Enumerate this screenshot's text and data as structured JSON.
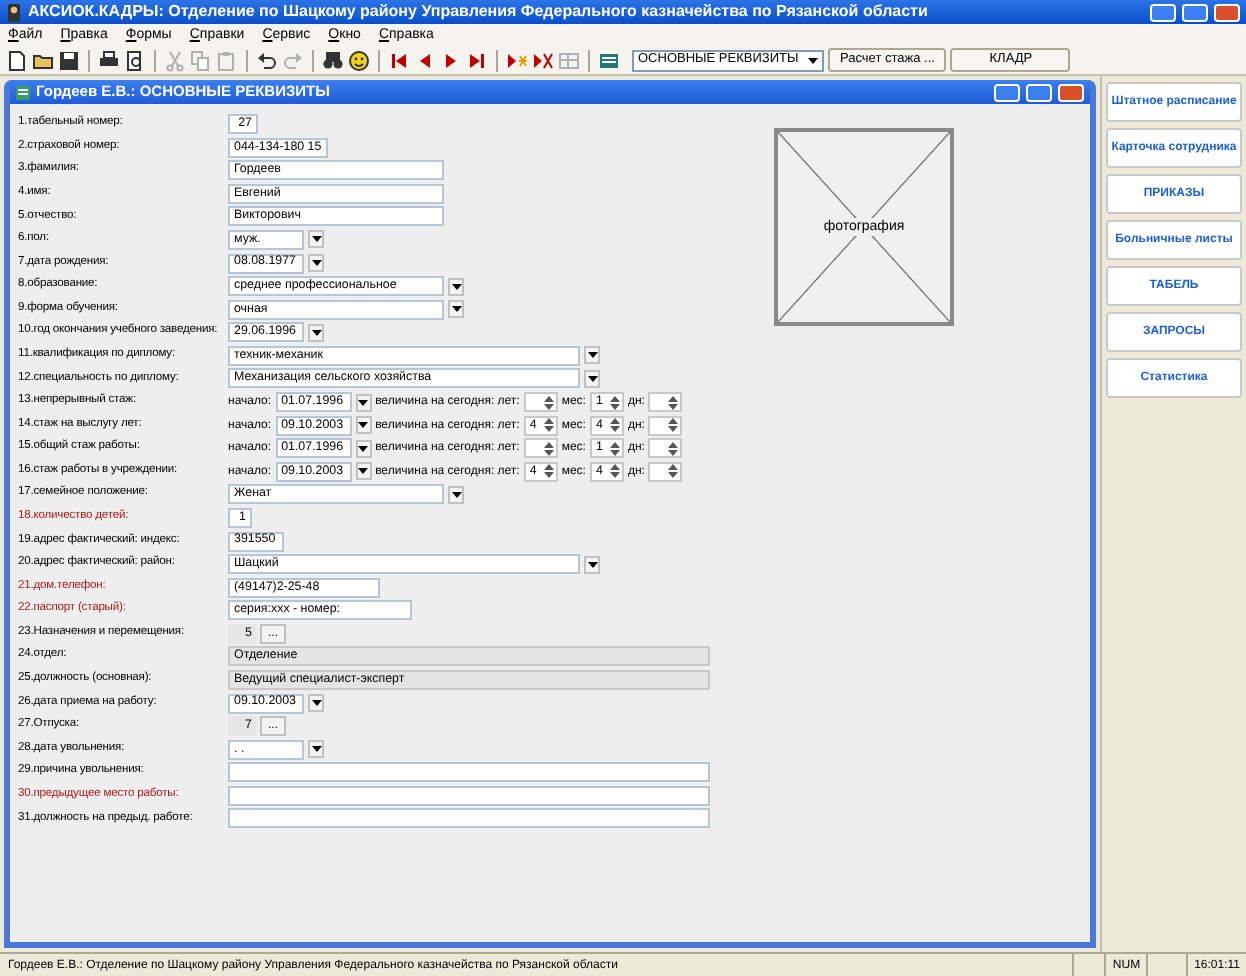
{
  "window": {
    "title": "АКСИОК.КАДРЫ: Отделение по Шацкому району Управления Федерального казначейства по Рязанской области"
  },
  "menu": [
    "Файл",
    "Правка",
    "Формы",
    "Справки",
    "Сервис",
    "Окно",
    "Справка"
  ],
  "toolbar": {
    "groups": [
      [
        {
          "kind": "new",
          "disabled": false
        },
        {
          "kind": "open",
          "disabled": false
        },
        {
          "kind": "save",
          "disabled": false
        }
      ],
      [
        {
          "kind": "print",
          "disabled": false
        },
        {
          "kind": "preview",
          "disabled": false
        }
      ],
      [
        {
          "kind": "cut",
          "disabled": true
        },
        {
          "kind": "copy",
          "disabled": true
        },
        {
          "kind": "paste",
          "disabled": true
        }
      ],
      [
        {
          "kind": "undo",
          "disabled": false
        },
        {
          "kind": "redo",
          "disabled": true
        }
      ],
      [
        {
          "kind": "find",
          "disabled": false
        },
        {
          "kind": "help",
          "disabled": false
        }
      ],
      [
        {
          "kind": "first",
          "disabled": false
        },
        {
          "kind": "prev",
          "disabled": false
        },
        {
          "kind": "next",
          "disabled": false
        },
        {
          "kind": "last",
          "disabled": false
        }
      ],
      [
        {
          "kind": "insert",
          "disabled": false
        },
        {
          "kind": "delete",
          "disabled": false
        },
        {
          "kind": "edit",
          "disabled": true
        }
      ],
      [
        {
          "kind": "form",
          "disabled": false
        }
      ]
    ],
    "form_select": "ОСНОВНЫЕ РЕКВИЗИТЫ",
    "buttons": [
      "Расчет стажа ...",
      "КЛАДР"
    ]
  },
  "document": {
    "title": "Гордеев Е.В.: ОСНОВНЫЕ РЕКВИЗИТЫ",
    "fields": [
      {
        "kind": "input",
        "label": "1.табельный номер:",
        "value": "27",
        "readonly": false,
        "required": false
      },
      {
        "kind": "input",
        "label": "2.страховой номер:",
        "value": "044-134-180 15",
        "readonly": false,
        "required": false
      },
      {
        "kind": "input",
        "label": "3.фамилия:",
        "value": "Гордеев",
        "readonly": false,
        "required": false
      },
      {
        "kind": "input",
        "label": "4.имя:",
        "value": "Евгений",
        "readonly": false,
        "required": false
      },
      {
        "kind": "input",
        "label": "5.отчество:",
        "value": "Викторович",
        "readonly": false,
        "required": false
      },
      {
        "kind": "dropdown",
        "label": "6.пол:",
        "value": "муж.",
        "required": false
      },
      {
        "kind": "dropdown",
        "label": "7.дата рождения:",
        "value": "08.08.1977",
        "required": false
      },
      {
        "kind": "dropdown",
        "label": "8.образование:",
        "value": "среднее профессиональное",
        "required": false
      },
      {
        "kind": "dropdown",
        "label": "9.форма обучения:",
        "value": "очная",
        "required": false
      },
      {
        "kind": "dropdown",
        "label": "10.год окончания учебного заведения:",
        "value": "29.06.1996",
        "required": false
      },
      {
        "kind": "dropdown",
        "label": "11.квалификация по диплому:",
        "value": "техник-механик",
        "required": false
      },
      {
        "kind": "dropdown",
        "label": "12.специальность по диплому:",
        "value": "Механизация сельского хозяйства",
        "required": false
      },
      {
        "kind": "stazh",
        "label": "13.непрерывный стаж:",
        "start_label": "начало:",
        "start": "01.07.1996",
        "amount_label": "величина на сегодня: лет:",
        "months_label": "мес:",
        "months": "1",
        "days_label": "дн:",
        "required": false
      },
      {
        "kind": "stazh",
        "label": "14.стаж на выслугу лет:",
        "start_label": "начало:",
        "start": "09.10.2003",
        "amount_label": "величина на сегодня: лет:",
        "years": "4",
        "months_label": "мес:",
        "months": "4",
        "days_label": "дн:",
        "required": false
      },
      {
        "kind": "stazh",
        "label": "15.общий стаж работы:",
        "start_label": "начало:",
        "start": "01.07.1996",
        "amount_label": "величина на сегодня: лет:",
        "months_label": "мес:",
        "months": "1",
        "days_label": "дн:",
        "required": false
      },
      {
        "kind": "stazh",
        "label": "16.стаж работы в учреждении:",
        "start_label": "начало:",
        "start": "09.10.2003",
        "amount_label": "величина на сегодня: лет:",
        "years": "4",
        "months_label": "мес:",
        "months": "4",
        "days_label": "дн:",
        "required": false
      },
      {
        "kind": "dropdown",
        "label": "17.семейное положение:",
        "value": "Женат",
        "required": false
      },
      {
        "kind": "input",
        "label": "18.количество детей:",
        "value": "1",
        "readonly": false,
        "required": true
      },
      {
        "kind": "input",
        "label": "19.адрес фактический: индекс:",
        "value": "391550",
        "readonly": false,
        "required": false
      },
      {
        "kind": "dropdown",
        "label": "20.адрес фактический: район:",
        "value": "Шацкий",
        "required": false
      },
      {
        "kind": "input",
        "label": "21.дом.телефон:",
        "value": "(49147)2-25-48",
        "readonly": false,
        "required": true
      },
      {
        "kind": "input",
        "label": "22.паспорт (старый):",
        "value": "серия:ххх  -  номер:",
        "readonly": false,
        "required": true
      },
      {
        "kind": "counter",
        "label": "23.Назначения и перемещения:",
        "value": "5",
        "button": "...",
        "required": false
      },
      {
        "kind": "input",
        "label": "24.отдел:",
        "value": "Отделение",
        "readonly": true,
        "required": false
      },
      {
        "kind": "input",
        "label": "25.должность (основная):",
        "value": "Ведущий специалист-эксперт",
        "readonly": true,
        "required": false
      },
      {
        "kind": "dropdown",
        "label": "26.дата приема на работу:",
        "value": "09.10.2003",
        "required": false
      },
      {
        "kind": "counter",
        "label": "27.Отпуска:",
        "value": "7",
        "button": "...",
        "required": false
      },
      {
        "kind": "dropdown",
        "label": "28.дата увольнения:",
        "value": ". .",
        "required": false
      },
      {
        "kind": "input",
        "label": "29.причина увольнения:",
        "readonly": false,
        "required": false
      },
      {
        "kind": "input",
        "label": "30.предыдущее место работы:",
        "readonly": false,
        "required": true
      },
      {
        "kind": "input",
        "label": "31.должность на предыд. работе:",
        "readonly": false,
        "required": false
      }
    ],
    "photo": {
      "caption": "фотография"
    }
  },
  "side_buttons": [
    "Штатное расписание",
    "Карточка сотрудника",
    "ПРИКАЗЫ",
    "Больничные листы",
    "ТАБЕЛЬ",
    "ЗАПРОСЫ",
    "Статистика"
  ],
  "status_bar": {
    "text": "Гордеев Е.В.: Отделение по Шацкому району Управления Федерального казначейства по Рязанской области",
    "num": "NUM",
    "time": "16:01:11"
  }
}
